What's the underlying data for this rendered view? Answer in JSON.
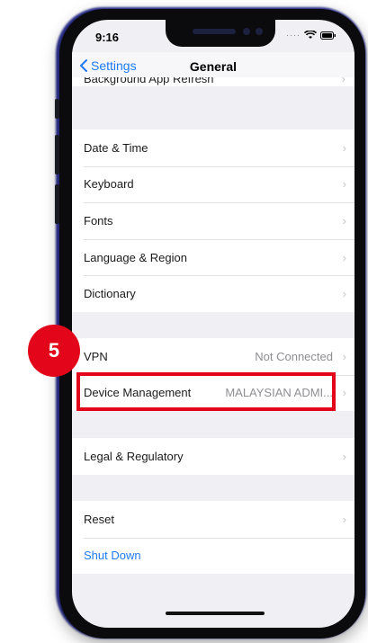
{
  "status": {
    "time": "9:16"
  },
  "nav": {
    "back_label": "Settings",
    "title": "General"
  },
  "cut_row": {
    "label": "Background App Refresh"
  },
  "group_1": [
    {
      "label": "Date & Time"
    },
    {
      "label": "Keyboard"
    },
    {
      "label": "Fonts"
    },
    {
      "label": "Language & Region"
    },
    {
      "label": "Dictionary"
    }
  ],
  "group_2": [
    {
      "label": "VPN",
      "value": "Not Connected"
    },
    {
      "label": "Device Management",
      "value": "MALAYSIAN ADMI..."
    }
  ],
  "group_3": [
    {
      "label": "Legal & Regulatory"
    }
  ],
  "group_4": [
    {
      "label": "Reset"
    },
    {
      "label": "Shut Down"
    }
  ],
  "annotation": {
    "step": "5",
    "color": "#e3061a"
  },
  "colors": {
    "accent": "#1e7bf2",
    "background": "#efeff4"
  }
}
